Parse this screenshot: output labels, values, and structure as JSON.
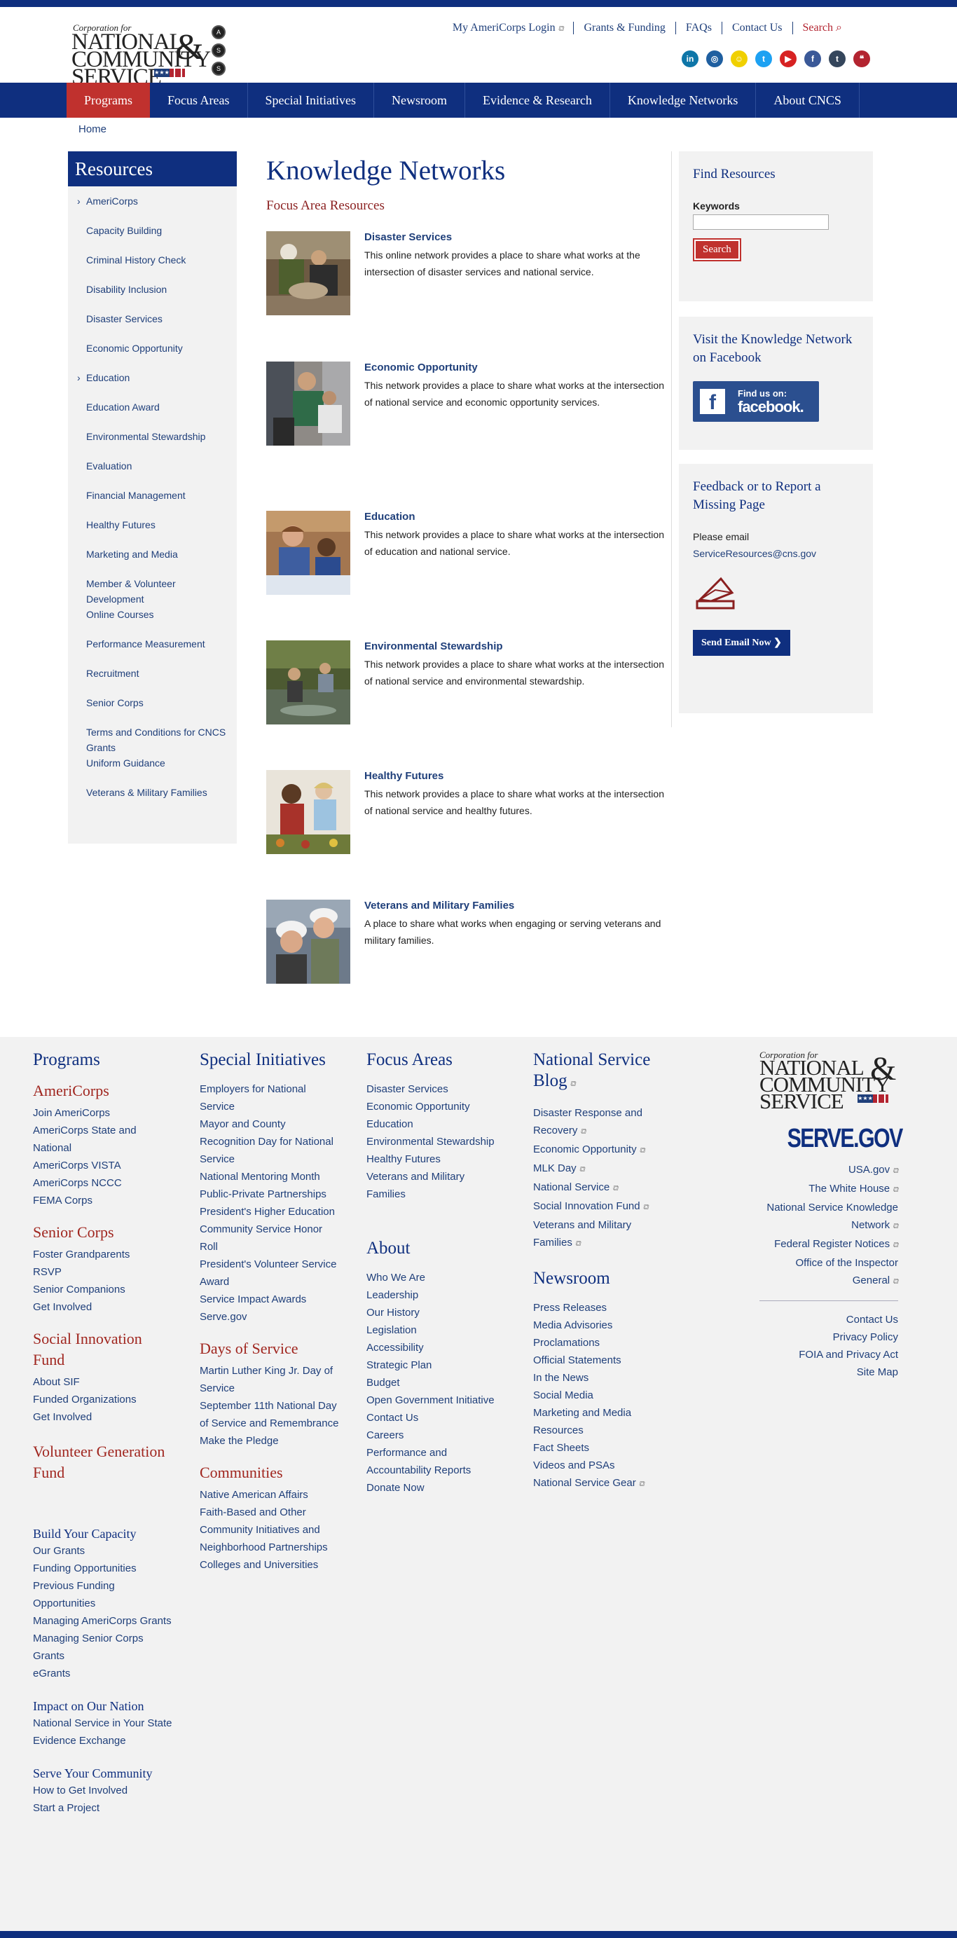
{
  "header": {
    "logo_corp": "Corporation for",
    "logo_line1": "NATIONAL",
    "logo_amp": "&",
    "logo_line2": "COMMUNITY",
    "logo_line3": "SERVICE",
    "util_links": [
      "My AmeriCorps Login",
      "Grants & Funding",
      "FAQs",
      "Contact Us"
    ],
    "search_label": "Search",
    "social": [
      {
        "name": "linkedin-icon",
        "glyph": "in",
        "color": "#0e76a8"
      },
      {
        "name": "instagram-icon",
        "glyph": "◎",
        "color": "#1f5fa0"
      },
      {
        "name": "snapchat-icon",
        "glyph": "☺",
        "color": "#f0d000"
      },
      {
        "name": "twitter-icon",
        "glyph": "t",
        "color": "#1da1f2"
      },
      {
        "name": "youtube-icon",
        "glyph": "▶",
        "color": "#d72222"
      },
      {
        "name": "facebook-icon",
        "glyph": "f",
        "color": "#3b5998"
      },
      {
        "name": "tumblr-icon",
        "glyph": "t",
        "color": "#35465c"
      },
      {
        "name": "speech-bubble-icon",
        "glyph": "❝",
        "color": "#b32430"
      }
    ]
  },
  "nav": {
    "items": [
      "Programs",
      "Focus Areas",
      "Special Initiatives",
      "Newsroom",
      "Evidence & Research",
      "Knowledge Networks",
      "About CNCS"
    ]
  },
  "breadcrumb": "Home",
  "sidebar": {
    "title": "Resources",
    "items": [
      "AmeriCorps",
      "Capacity Building",
      "Criminal History Check",
      "Disability Inclusion",
      "Disaster Services",
      "Economic Opportunity",
      "Education",
      "Education Award",
      "Environmental Stewardship",
      "Evaluation",
      "Financial Management",
      "Healthy Futures",
      "Marketing and Media",
      "Member & Volunteer Development",
      "Online Courses",
      "Performance Measurement",
      "Recruitment",
      "Senior Corps",
      "Terms and Conditions for CNCS Grants",
      "Uniform Guidance",
      "Veterans & Military Families"
    ],
    "expandable": [
      "AmeriCorps",
      "Education"
    ]
  },
  "main": {
    "title": "Knowledge Networks",
    "subtitle": "Focus Area Resources",
    "entries": [
      {
        "title": "Disaster Services",
        "desc": "This online network provides a place to share what works at the intersection of disaster services and national service."
      },
      {
        "title": "Economic Opportunity",
        "desc": "This network provides a place to share what works at the intersection of national service and economic opportunity services."
      },
      {
        "title": "Education",
        "desc": "This network provides a place to share what works at the intersection of education and national service."
      },
      {
        "title": "Environmental Stewardship",
        "desc": "This network provides a place to share what works at the intersection of national service and environmental stewardship."
      },
      {
        "title": "Healthy Futures",
        "desc": "This network provides a place to share what works at the intersection of national service and healthy futures."
      },
      {
        "title": "Veterans and Military Families",
        "desc": "A place to share what works when engaging or serving veterans and military families."
      }
    ]
  },
  "right": {
    "find_title": "Find Resources",
    "keywords_label": "Keywords",
    "search_button": "Search",
    "fb_title": "Visit the Knowledge Network on Facebook",
    "fb_line1": "Find us on:",
    "fb_line2": "facebook.",
    "feedback_title": "Feedback or to Report a Missing Page",
    "please_email": "Please email",
    "email": "ServiceResources@cns.gov",
    "send_button": "Send Email Now"
  },
  "footer": {
    "programs": {
      "title": "Programs",
      "americorps": {
        "title": "AmeriCorps",
        "links": [
          "Join AmeriCorps",
          "AmeriCorps State and National",
          "AmeriCorps VISTA",
          "AmeriCorps NCCC",
          "FEMA Corps"
        ]
      },
      "seniorcorps": {
        "title": "Senior Corps",
        "links": [
          "Foster Grandparents",
          "RSVP",
          "Senior Companions",
          "Get Involved"
        ]
      },
      "sif": {
        "title": "Social Innovation Fund",
        "links": [
          "About SIF",
          "Funded Organizations",
          "Get Involved"
        ]
      },
      "vgf": {
        "title": "Volunteer Generation Fund"
      },
      "capacity": {
        "title": "Build Your Capacity",
        "links": [
          "Our Grants",
          "Funding Opportunities",
          "Previous Funding Opportunities",
          "Managing AmeriCorps Grants",
          "Managing Senior Corps Grants",
          "eGrants"
        ]
      },
      "impact": {
        "title": "Impact on Our Nation",
        "links": [
          "National Service in Your State",
          "Evidence Exchange"
        ]
      },
      "serve": {
        "title": "Serve Your Community",
        "links": [
          "How to Get Involved",
          "Start a Project"
        ]
      }
    },
    "special": {
      "title": "Special Initiatives",
      "links": [
        "Employers for National Service",
        "Mayor and County Recognition Day for National Service",
        "National Mentoring Month",
        "Public-Private Partnerships",
        "President's Higher Education Community Service Honor Roll",
        "President's Volunteer Service Award",
        "Service Impact Awards",
        "Serve.gov"
      ],
      "days_title": "Days of Service",
      "days_links": [
        "Martin Luther King Jr. Day of Service",
        "September 11th National Day of Service and Remembrance",
        "Make the Pledge"
      ],
      "communities_title": "Communities",
      "communities_links": [
        "Native American Affairs",
        "Faith-Based and Other Community Initiatives and Neighborhood Partnerships",
        "Colleges and Universities"
      ]
    },
    "focus": {
      "title": "Focus Areas",
      "links": [
        "Disaster Services",
        "Economic Opportunity",
        "Education",
        "Environmental Stewardship",
        "Healthy Futures",
        "Veterans and Military Families"
      ],
      "about_title": "About",
      "about_links": [
        "Who We Are",
        "Leadership",
        "Our History",
        "Legislation",
        "Accessibility",
        "Strategic Plan",
        "Budget",
        "Open Government Initiative",
        "Contact Us",
        "Careers",
        "Performance and Accountability Reports",
        "Donate Now"
      ]
    },
    "blog": {
      "title": "National Service Blog",
      "links": [
        "Disaster Response and Recovery",
        "Economic Opportunity",
        "MLK Day",
        "National Service",
        "Social Innovation Fund",
        "Veterans and Military Families"
      ],
      "news_title": "Newsroom",
      "news_links": [
        "Press Releases",
        "Media Advisories",
        "Proclamations",
        "Official Statements",
        "In the News",
        "Social Media",
        "Marketing and Media Resources",
        "Fact Sheets",
        "Videos and PSAs",
        "National Service Gear"
      ]
    },
    "right": {
      "serve_gov": "SERVE.GOV",
      "ext_links": [
        "USA.gov",
        "The White House",
        "National Service Knowledge Network",
        "Federal Register Notices",
        "Office of the Inspector General"
      ],
      "bottom_links": [
        "Contact Us",
        "Privacy Policy",
        "FOIA and Privacy Act",
        "Site Map"
      ]
    }
  }
}
